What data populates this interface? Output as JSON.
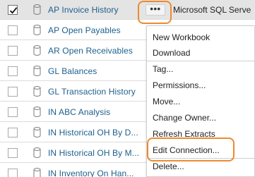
{
  "rows": [
    {
      "name": "AP Invoice History",
      "connection": "Microsoft SQL Serve",
      "checked": true,
      "selected": true
    },
    {
      "name": "AP Open Payables",
      "checked": false
    },
    {
      "name": "AR Open Receivables",
      "checked": false
    },
    {
      "name": "GL Balances",
      "checked": false
    },
    {
      "name": "GL Transaction History",
      "checked": false
    },
    {
      "name": "IN ABC Analysis",
      "checked": false
    },
    {
      "name": "IN Historical OH By D...",
      "checked": false
    },
    {
      "name": "IN Historical OH By M...",
      "checked": false
    },
    {
      "name": "IN Inventory On Han...",
      "checked": false
    }
  ],
  "more_button": {
    "label": "•••",
    "icon": "ellipsis-icon"
  },
  "context_menu": {
    "items": [
      "New Workbook",
      "Download",
      "Tag...",
      "Permissions...",
      "Move...",
      "Change Owner...",
      "Refresh Extracts",
      "Edit Connection...",
      "Delete..."
    ],
    "highlighted": "Edit Connection..."
  },
  "colors": {
    "link": "#1b5f8c",
    "highlight_outline": "#ee8a2f",
    "selected_row": "#e4e4e4"
  }
}
